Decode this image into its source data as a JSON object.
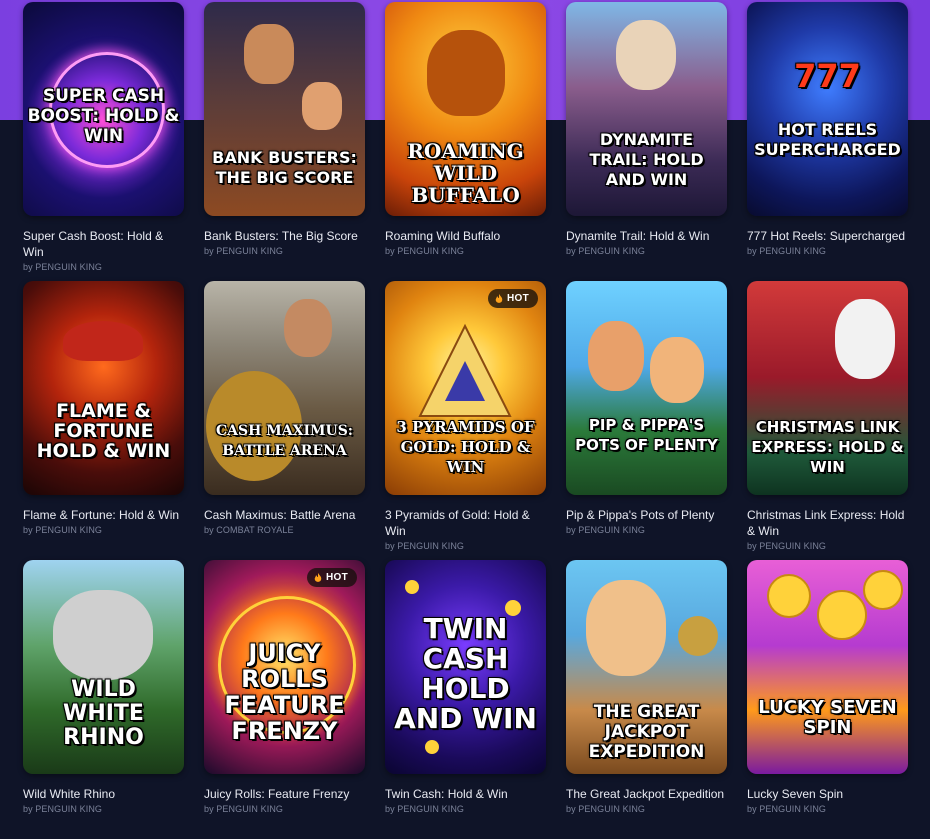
{
  "games": [
    {
      "name": "Super Cash Boost: Hold & Win",
      "provider": "by PENGUIN KING",
      "art_title": "SUPER CASH BOOST: HOLD & WIN",
      "hot": false
    },
    {
      "name": "Bank Busters: The Big Score",
      "provider": "by PENGUIN KING",
      "art_title": "BANK BUSTERS: THE BIG SCORE",
      "hot": false
    },
    {
      "name": "Roaming Wild Buffalo",
      "provider": "by PENGUIN KING",
      "art_title": "ROAMING WILD BUFFALO",
      "hot": false
    },
    {
      "name": "Dynamite Trail: Hold & Win",
      "provider": "by PENGUIN KING",
      "art_title": "DYNAMITE TRAIL: HOLD AND WIN",
      "hot": false
    },
    {
      "name": "777 Hot Reels: Supercharged",
      "provider": "by PENGUIN KING",
      "art_title": "HOT REELS SUPERCHARGED",
      "hot": false
    },
    {
      "name": "Flame & Fortune: Hold & Win",
      "provider": "by PENGUIN KING",
      "art_title": "FLAME & FORTUNE HOLD & WIN",
      "hot": false
    },
    {
      "name": "Cash Maximus: Battle Arena",
      "provider": "by COMBAT ROYALE",
      "art_title": "CASH MAXIMUS: BATTLE ARENA",
      "hot": false
    },
    {
      "name": "3 Pyramids of Gold: Hold & Win",
      "provider": "by PENGUIN KING",
      "art_title": "3 PYRAMIDS OF GOLD: HOLD & WIN",
      "hot": true
    },
    {
      "name": "Pip & Pippa's Pots of Plenty",
      "provider": "by PENGUIN KING",
      "art_title": "PIP & PIPPA'S Pots of Plenty",
      "hot": false
    },
    {
      "name": "Christmas Link Express: Hold & Win",
      "provider": "by PENGUIN KING",
      "art_title": "CHRISTMAS LINK EXPRESS: HOLD & WIN",
      "hot": false
    },
    {
      "name": "Wild White Rhino",
      "provider": "by PENGUIN KING",
      "art_title": "WILD WHITE RHINO",
      "hot": false
    },
    {
      "name": "Juicy Rolls: Feature Frenzy",
      "provider": "by PENGUIN KING",
      "art_title": "JUICY ROLLS FEATURE FRENZY",
      "hot": true
    },
    {
      "name": "Twin Cash: Hold & Win",
      "provider": "by PENGUIN KING",
      "art_title": "TWIN CASH HOLD AND WIN",
      "hot": false
    },
    {
      "name": "The Great Jackpot Expedition",
      "provider": "by PENGUIN KING",
      "art_title": "THE GREAT JACKPOT EXPEDITION",
      "hot": false
    },
    {
      "name": "Lucky Seven Spin",
      "provider": "by PENGUIN KING",
      "art_title": "LUCKY SEVEN SPIN",
      "hot": false
    }
  ],
  "hot_label": "HOT",
  "colors": {
    "top_band": "#8e4ae6",
    "page_bg": "#0f1428",
    "hot_badge": "#14100c"
  }
}
